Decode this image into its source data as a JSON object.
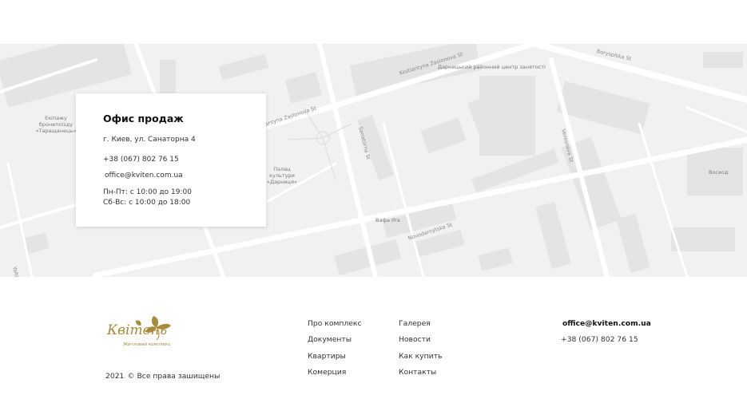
{
  "map": {
    "labels": {
      "label_1": "Дарницький районний центр занятості",
      "label_2": "Екіпажу бронепоїзду «Таращанець»",
      "label_3": "Палац культури «Дарниця»",
      "label_4": "Вафа Ifra",
      "label_5": "Восход"
    },
    "streets": {
      "s1": "Kostiantyna Zaslonova St",
      "s2": "Borysplska St",
      "s3": "antyna Zaslonova St",
      "s4": "Sanatorna St",
      "s5": "Veresneva St",
      "s6": "Novodarnytska St",
      "s7": "Yalta"
    }
  },
  "office": {
    "title": "Офис продаж",
    "address": "г. Киев, ул. Санаторна 4",
    "phone": "+38 (067) 802 76 15",
    "email": "office@kviten.com.ua",
    "hours_weekdays": "Пн-Пт: с 10:00 до 19:00",
    "hours_weekend": "Сб-Вс: с 10:00 до 18:00"
  },
  "footer": {
    "logo_text": "Квітень",
    "logo_subtitle": "Житловий комплекс",
    "copyright_year": "2021",
    "copyright_text": "© Все права зашищены",
    "nav_col1": [
      "Про комплекс",
      "Документы",
      "Квартиры",
      "Комерция"
    ],
    "nav_col2": [
      "Галерея",
      "Новости",
      "Как купить",
      "Контакты"
    ],
    "contact_email": "office@kviten.com.ua",
    "contact_phone": "+38 (067) 802 76 15"
  },
  "colors": {
    "map_background": "#f1f1f1",
    "logo_gold": "#a88a3a"
  }
}
